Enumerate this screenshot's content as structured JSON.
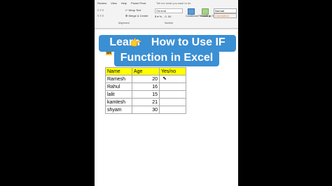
{
  "ribbon": {
    "menu": [
      "Review",
      "View",
      "Help",
      "Power Pivot"
    ],
    "tell_me": "Tell me what you want to do",
    "wrap_text": "Wrap Text",
    "merge_center": "Merge & Center",
    "number_format": "General",
    "cond_format": "Conditional Formatting",
    "format_table": "Format as Table",
    "style_normal": "Normal",
    "style_calc": "Calculation",
    "group_alignment": "Alignment",
    "group_number": "Number"
  },
  "banner": {
    "line1_a": "Learn",
    "line1_b": "How to Use IF",
    "line2": "Function in Excel",
    "hand_icon": "pointing-hand"
  },
  "fragment": "th",
  "table": {
    "headers": [
      "Name",
      "Age",
      "Yes/no"
    ],
    "rows": [
      {
        "name": "Ramesh",
        "age": "20",
        "yes": ""
      },
      {
        "name": "Rahul",
        "age": "16",
        "yes": ""
      },
      {
        "name": "lalit",
        "age": "15",
        "yes": ""
      },
      {
        "name": "kamlesh",
        "age": "21",
        "yes": ""
      },
      {
        "name": "shyam",
        "age": "30",
        "yes": ""
      }
    ]
  },
  "colors": {
    "banner": "#3b8fd3",
    "header_fill": "#ffff00"
  }
}
